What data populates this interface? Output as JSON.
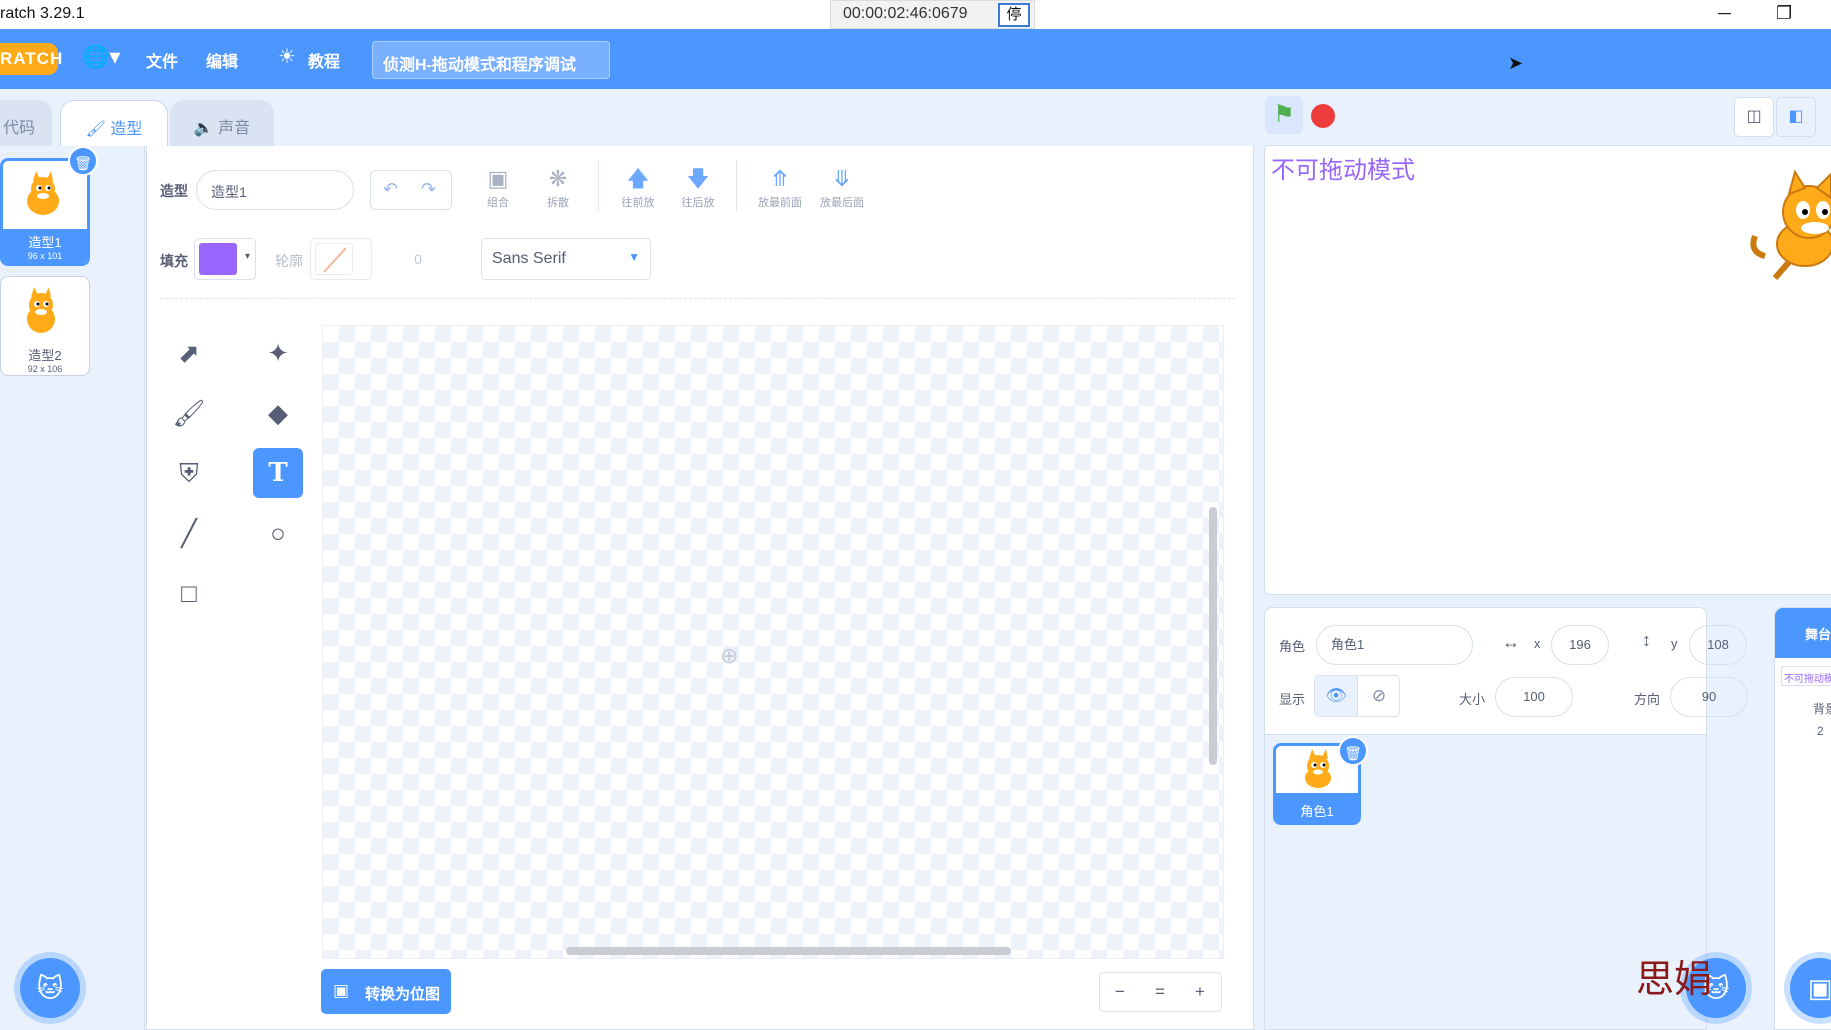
{
  "window": {
    "title": "ratch 3.29.1",
    "timer": "00:00:02:46:0679",
    "timer_stop": "停",
    "minimize": "─",
    "restore": "❐"
  },
  "menubar": {
    "logo": "RATCH",
    "language_icon": "globe-icon",
    "file": "文件",
    "edit": "编辑",
    "tutorials": "教程",
    "project_title": "侦测H-拖动模式和程序调试"
  },
  "tabs": {
    "code": "代码",
    "costumes": "造型",
    "sounds": "声音"
  },
  "costumes": [
    {
      "index": "1",
      "name": "造型1",
      "size": "96 x 101"
    },
    {
      "index": "2",
      "name": "造型2",
      "size": "92 x 106"
    }
  ],
  "editor": {
    "costume_label": "造型",
    "costume_name": "造型1",
    "group": "组合",
    "ungroup": "拆散",
    "forward": "往前放",
    "backward": "往后放",
    "front": "放最前面",
    "back": "放最后面",
    "fill_label": "填充",
    "fill_color": "#9966ff",
    "outline_label": "轮廓",
    "outline_width": "0",
    "font": "Sans Serif",
    "convert_button": "转换为位图",
    "zoom_out": "−",
    "zoom_reset": "=",
    "zoom_in": "+"
  },
  "stage": {
    "text": "不可拖动模式"
  },
  "sprite_info": {
    "sprite_label": "角色",
    "sprite_name": "角色1",
    "x_label": "x",
    "x": "196",
    "y_label": "y",
    "y": "108",
    "show_label": "显示",
    "size_label": "大小",
    "size": "100",
    "direction_label": "方向",
    "direction": "90"
  },
  "sprites": [
    {
      "name": "角色1"
    }
  ],
  "stage_pane": {
    "header": "舞台",
    "thumb_text": "不可拖动模式",
    "backdrops_label": "背景",
    "backdrops_count": "2"
  },
  "watermark": "思娟",
  "colors": {
    "accent": "#4c97ff",
    "logo": "#ffab19",
    "purple": "#9966ff"
  }
}
